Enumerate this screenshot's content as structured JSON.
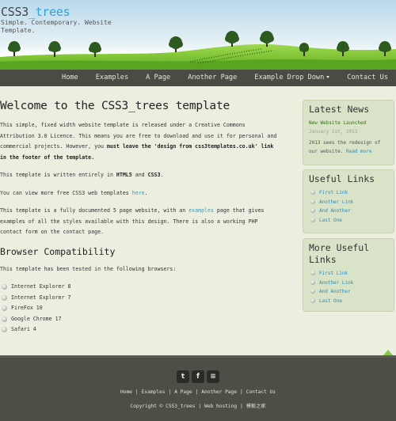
{
  "header": {
    "logo_main": "CSS3",
    "logo_highlight": "_trees",
    "slogan": "Simple. Contemporary. Website Template."
  },
  "menu": [
    {
      "label": "Home"
    },
    {
      "label": "Examples"
    },
    {
      "label": "A Page"
    },
    {
      "label": "Another Page"
    },
    {
      "label": "Example Drop Down",
      "dropdown": true
    },
    {
      "label": "Contact Us"
    }
  ],
  "content": {
    "title": "Welcome to the CSS3_trees template",
    "p1_text": "This simple, fixed width website template is released under a Creative Commons Attribution 3.0 Licence. This means you are free to download and use it for personal and commercial projects. However, you ",
    "p1_bold": "must leave the 'design from css3templates.co.uk' link in the footer of the template.",
    "p2_text": "This template is written entirely in ",
    "p2_b1": "HTML5",
    "p2_and": " and ",
    "p2_b2": "CSS3",
    "p2_end": ".",
    "p3_text": "You can view more free CSS3 web templates ",
    "p3_link": "here",
    "p3_end": ".",
    "p4_text1": "This template is a fully documented 5 page website, with an ",
    "p4_link": "examples",
    "p4_text2": " page that gives examples of all the styles available with this design. There is also a working PHP contact form on the contact page.",
    "subtitle": "Browser Compatibility",
    "compat_intro": "This template has been tested in the following browsers:",
    "browsers": [
      "Internet Explorer 8",
      "Internet Explorer 7",
      "FireFox 10",
      "Google Chrome 17",
      "Safari 4"
    ]
  },
  "sidebar": {
    "news_title": "Latest News",
    "news_headline": "New Website Launched",
    "news_date": "January 1st, 2013",
    "news_body": "2013 sees the redesign of our website. ",
    "news_more": "Read more",
    "useful_title": "Useful Links",
    "useful_links": [
      "First Link",
      "Another Link",
      "And Another",
      "Last One"
    ],
    "more_title": "More Useful Links",
    "more_links": [
      "First Link",
      "Another Link",
      "And Another",
      "Last One"
    ]
  },
  "footer": {
    "social": [
      {
        "icon": "twitter-icon",
        "glyph": "t"
      },
      {
        "icon": "facebook-icon",
        "glyph": "f"
      },
      {
        "icon": "rss-icon",
        "glyph": "≡"
      }
    ],
    "nav": [
      "Home",
      "Examples",
      "A Page",
      "Another Page",
      "Contact Us"
    ],
    "copyright": "Copyright © CSS3_trees",
    "link1": "Web hosting",
    "link2": "模板之家"
  },
  "colors": {
    "accent": "#29a5d6",
    "menu_bg": "#4b4b44",
    "page_bg": "#ecefe0",
    "sidebar_bg": "#d9e3c8",
    "grass": "#7cc63a"
  }
}
